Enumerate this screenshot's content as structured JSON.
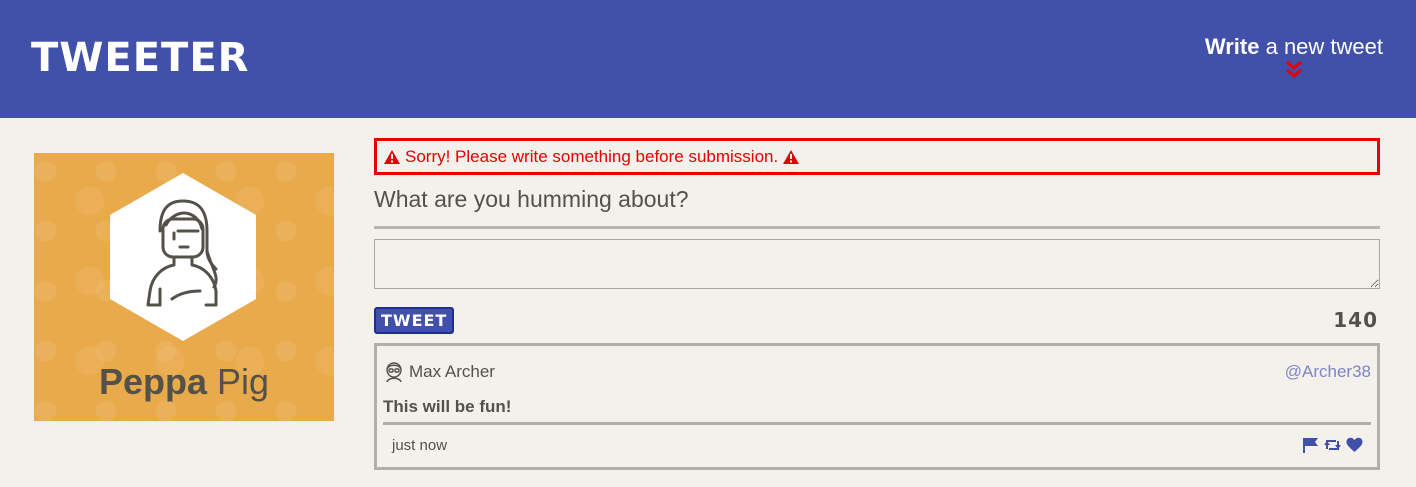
{
  "header": {
    "brand": "TWEETER",
    "compose_bold": "Write",
    "compose_rest": " a new tweet",
    "chevron_icon": "double-chevron-down-icon",
    "chevron_color": "#e60000",
    "background": "#4150a8"
  },
  "profile": {
    "first_name": "Peppa",
    "last_name": " Pig",
    "card_color": "#e9aa4c"
  },
  "composer": {
    "error_message": "Sorry! Please write something before submission.",
    "warning_icon": "warning-triangle-icon",
    "question": "What are you humming about?",
    "textarea_value": "",
    "button_label": "TWEET",
    "counter": "140"
  },
  "tweets": [
    {
      "author": "Max Archer",
      "handle": "@Archer38",
      "text": "This will be fun!",
      "time": "just now",
      "avatar_icon": "avatar-icon",
      "actions": [
        "flag-icon",
        "retweet-icon",
        "heart-icon"
      ]
    }
  ]
}
